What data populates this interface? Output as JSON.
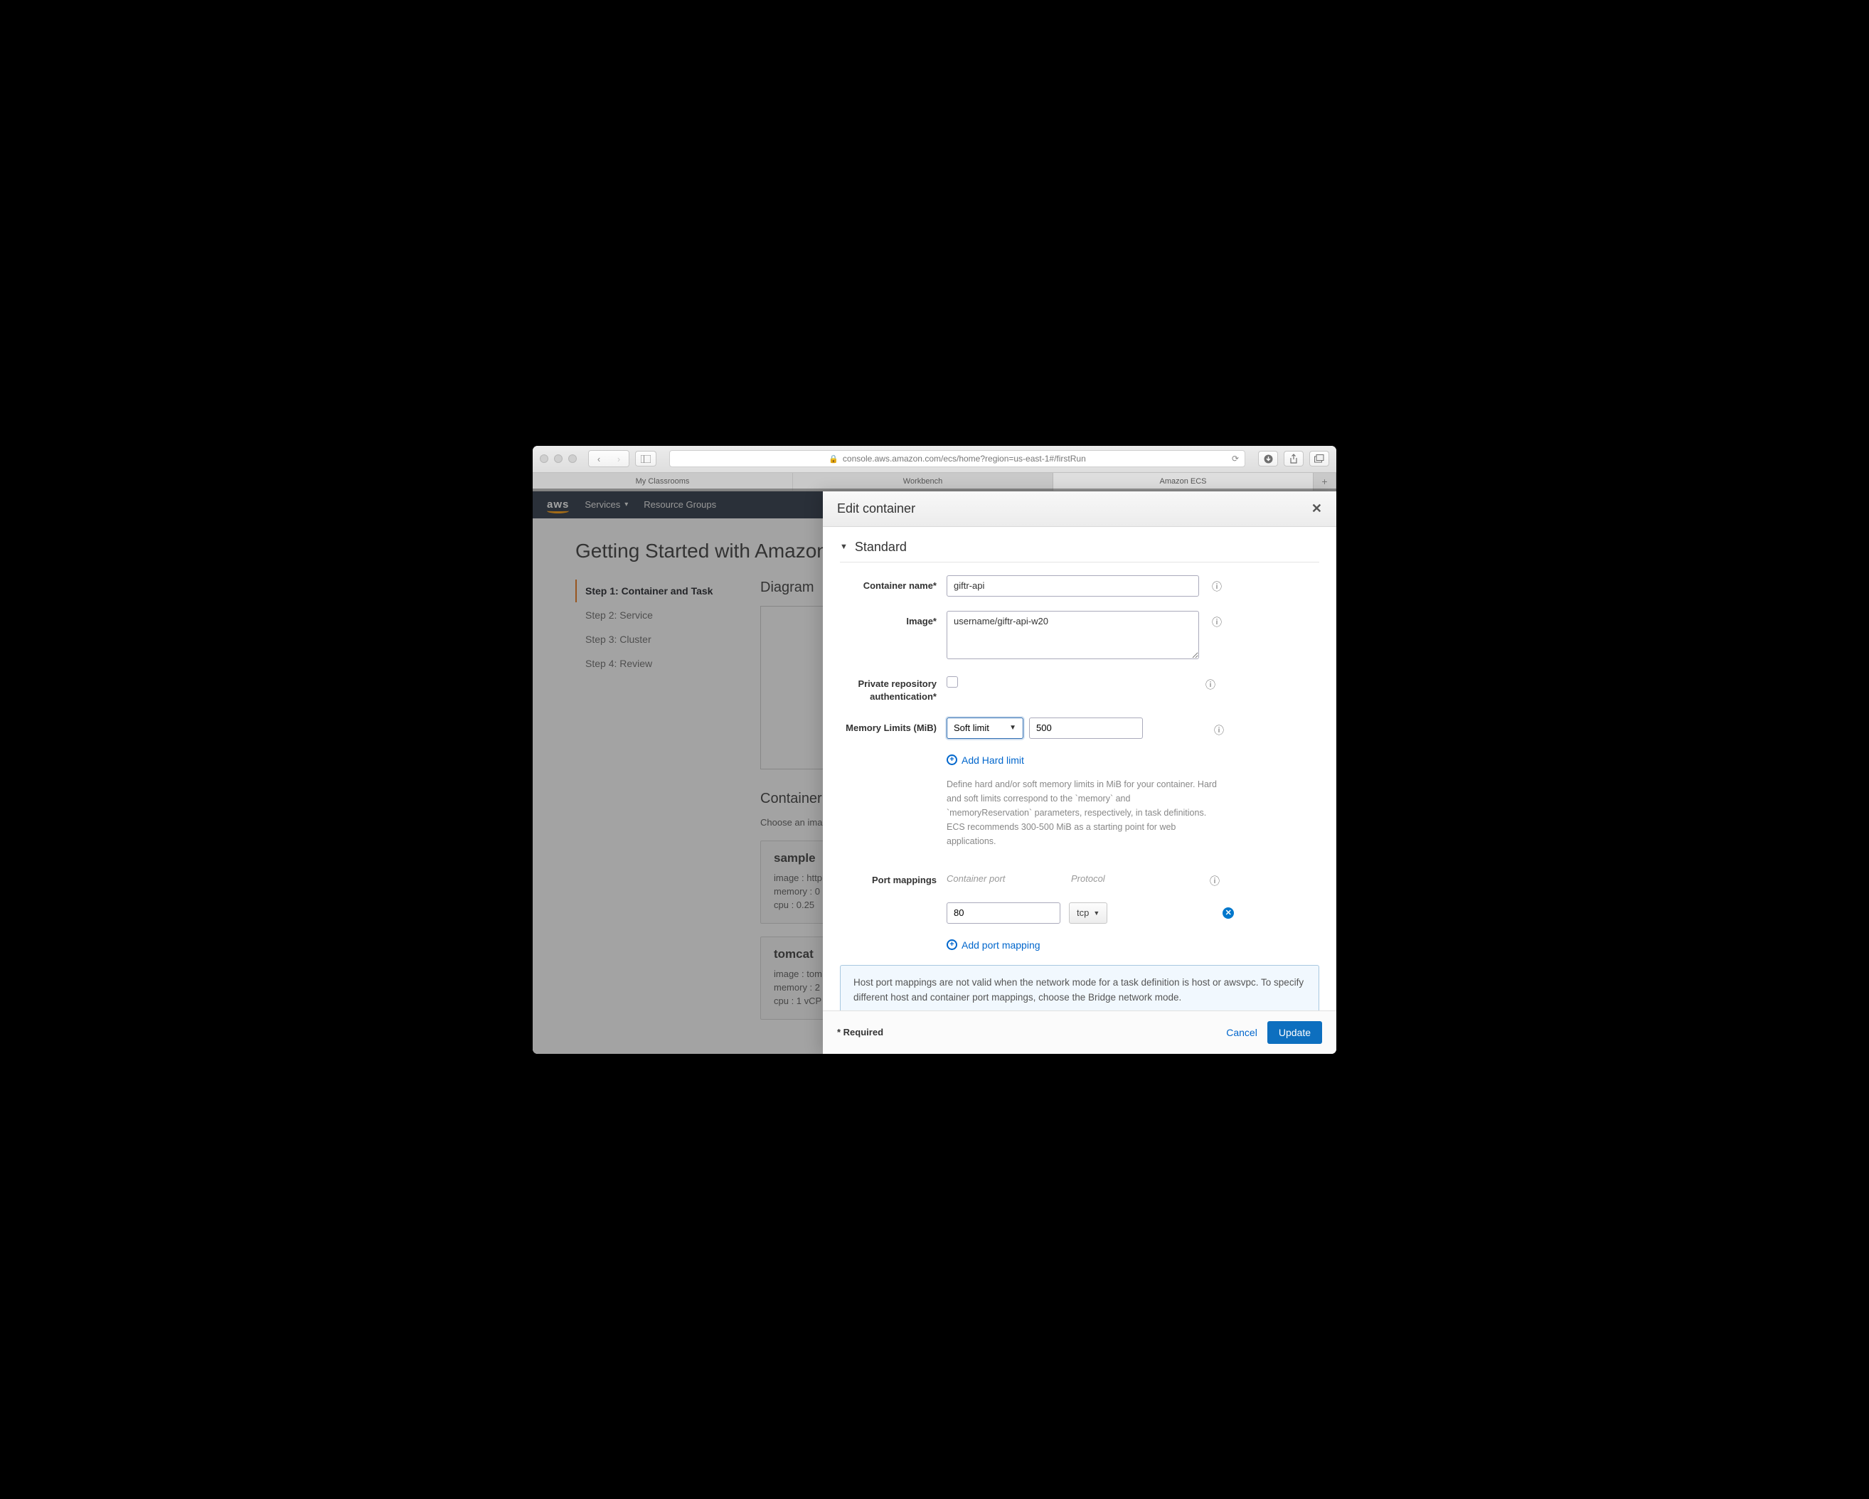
{
  "browser": {
    "url": "console.aws.amazon.com/ecs/home?region=us-east-1#/firstRun",
    "tabs": [
      "My Classrooms",
      "Workbench",
      "Amazon ECS"
    ],
    "active_tab_index": 2
  },
  "awsnav": {
    "logo": "aws",
    "services": "Services",
    "resource_groups": "Resource Groups"
  },
  "page": {
    "title": "Getting Started with Amazon",
    "steps": [
      "Step 1: Container and Task",
      "Step 2: Service",
      "Step 3: Cluster",
      "Step 4: Review"
    ],
    "active_step": 0,
    "diagram_label": "Diagram",
    "container_heading": "Container",
    "choose_label": "Choose an ima",
    "cards": [
      {
        "title": "sample",
        "image": "image : http",
        "memory": "memory :  0",
        "cpu": "cpu :  0.25"
      },
      {
        "title": "tomcat",
        "image": "image : tom",
        "memory": "memory :  2",
        "cpu": "cpu :  1 vCP"
      }
    ]
  },
  "modal": {
    "title": "Edit container",
    "section": "Standard",
    "labels": {
      "container_name": "Container name*",
      "image": "Image*",
      "private_repo": "Private repository authentication*",
      "memory": "Memory Limits (MiB)",
      "port_mappings": "Port mappings"
    },
    "values": {
      "container_name": "giftr-api",
      "image": "username/giftr-api-w20",
      "memory_type": "Soft limit",
      "memory_value": "500",
      "add_hard": "Add Hard limit",
      "help1": "Define hard and/or soft memory limits in MiB for your container. Hard and soft limits correspond to the `memory` and `memoryReservation` parameters, respectively, in task definitions.",
      "help2": "ECS recommends 300-500 MiB as a starting point for web applications.",
      "port_headers": {
        "container": "Container port",
        "protocol": "Protocol"
      },
      "port": "80",
      "protocol": "tcp",
      "add_port": "Add port mapping",
      "infobox": "Host port mappings are not valid when the network mode for a task definition is host or awsvpc. To specify different host and container port mappings, choose the Bridge network mode."
    },
    "footer": {
      "required": "* Required",
      "cancel": "Cancel",
      "update": "Update"
    }
  }
}
